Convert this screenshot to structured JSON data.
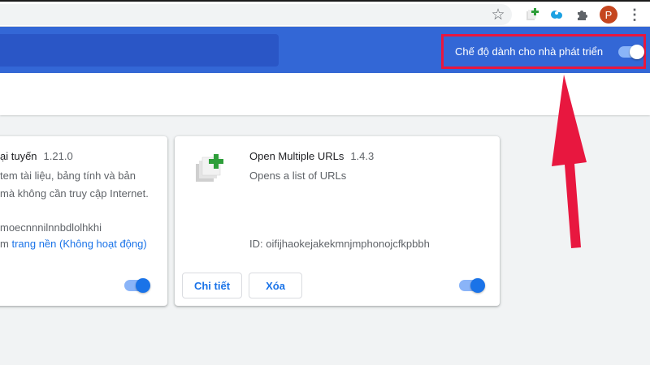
{
  "toolbar": {
    "star_icon": "star-icon",
    "avatar_letter": "P",
    "colors": {
      "avatar": "#c5461f"
    }
  },
  "header": {
    "dev_mode_label": "Chế độ dành cho nhà phát triển",
    "dev_mode_enabled": true,
    "colors": {
      "header": "#3367d6",
      "highlight_border": "#e8173f"
    }
  },
  "extensions": [
    {
      "name_visible": "ại tuyến",
      "version": "1.21.0",
      "description_line1": "tem tài liệu, bảng tính và bản",
      "description_line2": "mà không cần truy cập Internet.",
      "id_visible": "moecnnnilnnbdlolhkhi",
      "view_prefix": "m ",
      "view_link": "trang nền (Không hoạt động)",
      "enabled": true
    },
    {
      "name": "Open Multiple URLs",
      "version": "1.4.3",
      "description": "Opens a list of URLs",
      "id": "ID: oifijhaokejakekmnjmphonojcfkpbbh",
      "details_label": "Chi tiết",
      "remove_label": "Xóa",
      "enabled": true
    }
  ],
  "accent_color": "#1a73e8"
}
